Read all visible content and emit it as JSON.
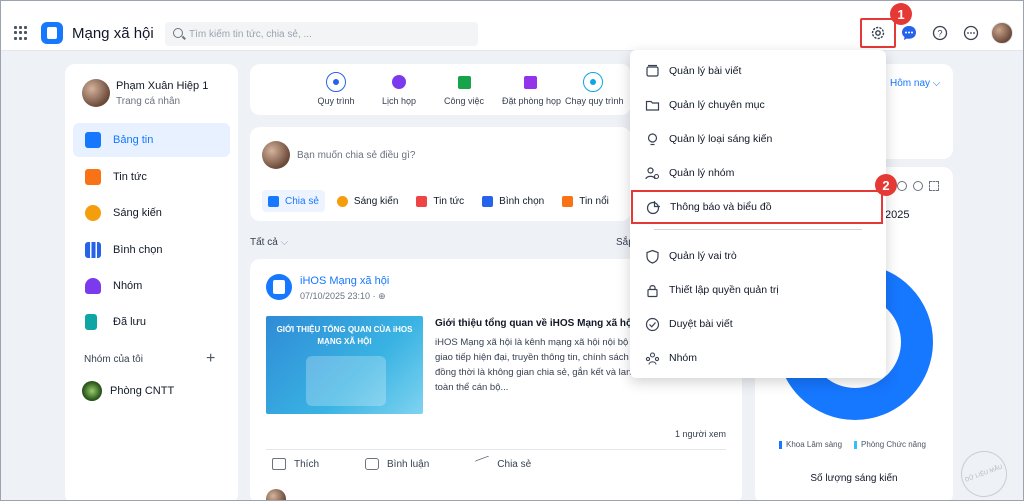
{
  "app": {
    "title": "Mạng xã hội"
  },
  "search": {
    "placeholder": "Tìm kiếm tin tức, chia sẻ, ..."
  },
  "steps": {
    "one": "1",
    "two": "2"
  },
  "profile": {
    "name": "Phạm Xuân Hiệp 1",
    "subtitle": "Trang cá nhân"
  },
  "sidebar": {
    "items": [
      {
        "label": "Bảng tin",
        "color": "#1677ff"
      },
      {
        "label": "Tin tức",
        "color": "#f97316"
      },
      {
        "label": "Sáng kiến",
        "color": "#f59e0b"
      },
      {
        "label": "Bình chọn",
        "color": "#2563eb"
      },
      {
        "label": "Nhóm",
        "color": "#7c3aed"
      },
      {
        "label": "Đã lưu",
        "color": "#0ea5a4"
      }
    ],
    "groups_title": "Nhóm của tôi",
    "groups_add": "+",
    "groups": [
      {
        "label": "Phòng CNTT"
      }
    ]
  },
  "quick_actions": [
    {
      "label": "Quy trình",
      "color": "#2563eb"
    },
    {
      "label": "Lịch họp",
      "color": "#7c3aed"
    },
    {
      "label": "Công việc",
      "color": "#16a34a"
    },
    {
      "label": "Đặt phòng họp",
      "color": "#9333ea"
    },
    {
      "label": "Chạy quy trình",
      "color": "#0ea5e9"
    }
  ],
  "composer": {
    "placeholder": "Bạn muốn chia sẻ điều gì?",
    "actions": [
      {
        "label": "Chia sẻ",
        "color": "#1677ff"
      },
      {
        "label": "Sáng kiến",
        "color": "#f59e0b"
      },
      {
        "label": "Tin tức",
        "color": "#ef4444"
      },
      {
        "label": "Bình chọn",
        "color": "#2563eb"
      },
      {
        "label": "Tin nổi",
        "color": "#f97316"
      }
    ]
  },
  "feed": {
    "filter": "Tất cả",
    "sort": "Sắp"
  },
  "post": {
    "author": "iHOS Mạng xã hội",
    "date": "07/10/2025 23:10",
    "image_title": "GIỚI THIỆU TỔNG QUAN CỦA iHOS MẠNG XÃ HỘI",
    "title": "Giới thiệu tổng quan về iHOS Mạng xã hội",
    "body": "iHOS Mạng xã hội là kênh mạng xã hội nội bộ bệnh viện, tạo cầu nối giao tiếp hiện đại, truyền thông tin, chính sách từ ban lãnh đạo tới, đồng thời là không gian chia sẻ, gắn kết và lan tỏa sáng kiến trong toàn thể cán bộ...",
    "views": "1 người xem",
    "actions": {
      "like": "Thích",
      "comment": "Bình luận",
      "share": "Chia sẻ"
    }
  },
  "right_panel": {
    "date_filter": "Hôm nay",
    "chart_year": "2025",
    "chart_caption": "Số lượng sáng kiến"
  },
  "chart_data": {
    "type": "pie",
    "title": "",
    "series": [
      {
        "name": "Khoa Lâm sàng",
        "color": "#1677ff",
        "values": [
          100
        ]
      },
      {
        "name": "Phòng Chức năng",
        "color": "#38bdf8",
        "values": [
          0
        ]
      }
    ],
    "caption": "Số lượng sáng kiến"
  },
  "dropdown": {
    "items": [
      {
        "label": "Quản lý bài viết",
        "icon": "stack-icon"
      },
      {
        "label": "Quản lý chuyên mục",
        "icon": "folder-icon"
      },
      {
        "label": "Quản lý loại sáng kiến",
        "icon": "lightbulb-icon"
      },
      {
        "label": "Quản lý nhóm",
        "icon": "users-gear-icon"
      },
      {
        "label": "Thông báo và biểu đồ",
        "icon": "pie-chart-icon"
      },
      {
        "label": "Quản lý vai trò",
        "icon": "shield-icon"
      },
      {
        "label": "Thiết lập quyền quản trị",
        "icon": "lock-icon"
      },
      {
        "label": "Duyệt bài viết",
        "icon": "check-circle-icon"
      },
      {
        "label": "Nhóm",
        "icon": "group-icon"
      }
    ]
  },
  "watermark": "DỮ LIỆU MẪU"
}
